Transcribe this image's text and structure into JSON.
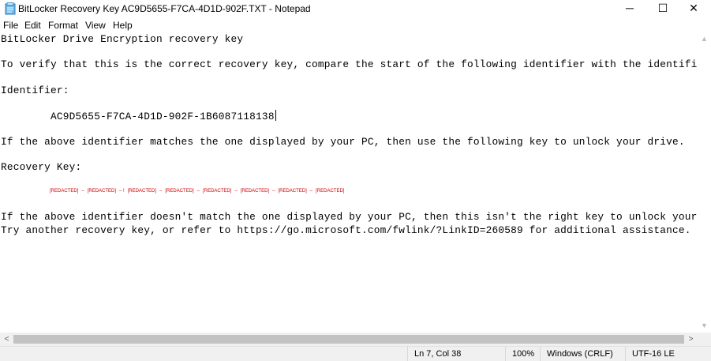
{
  "window": {
    "title": "BitLocker Recovery Key AC9D5655-F7CA-4D1D-902F.TXT - Notepad",
    "minimize": "─",
    "maximize": "☐",
    "close": "✕"
  },
  "menu": {
    "items": [
      "File",
      "Edit",
      "Format",
      "View",
      "Help"
    ]
  },
  "document": {
    "lines": [
      "BitLocker Drive Encryption recovery key",
      "To verify that this is the correct recovery key, compare the start of the following identifier with the identifier value di",
      "Identifier:",
      "        AC9D5655-F7CA-4D1D-902F-1B6087118138",
      "If the above identifier matches the one displayed by your PC, then use the following key to unlock your drive.",
      "Recovery Key:",
      "If the above identifier doesn't match the one displayed by your PC, then this isn't the right key to unlock your drive.",
      "Try another recovery key, or refer to https://go.microsoft.com/fwlink/?LinkID=260589 for additional assistance."
    ],
    "redacted_segments": [
      "[REDACTED]",
      "[REDACTED]",
      "[REDACTED]",
      "[REDACTED]",
      "[REDACTED]",
      "[REDACTED]",
      "[REDACTED]",
      "[REDACTED]"
    ],
    "redacted_separators": [
      "–",
      "– !",
      "–",
      "–",
      "–",
      "–",
      "–"
    ]
  },
  "statusbar": {
    "position": "Ln 7, Col 38",
    "zoom": "100%",
    "line_ending": "Windows (CRLF)",
    "encoding": "UTF-16 LE"
  },
  "icons": {
    "app": "notepad-icon",
    "scroll_up": "▲",
    "scroll_down": "▼",
    "scroll_left": "<",
    "scroll_right": ">"
  }
}
